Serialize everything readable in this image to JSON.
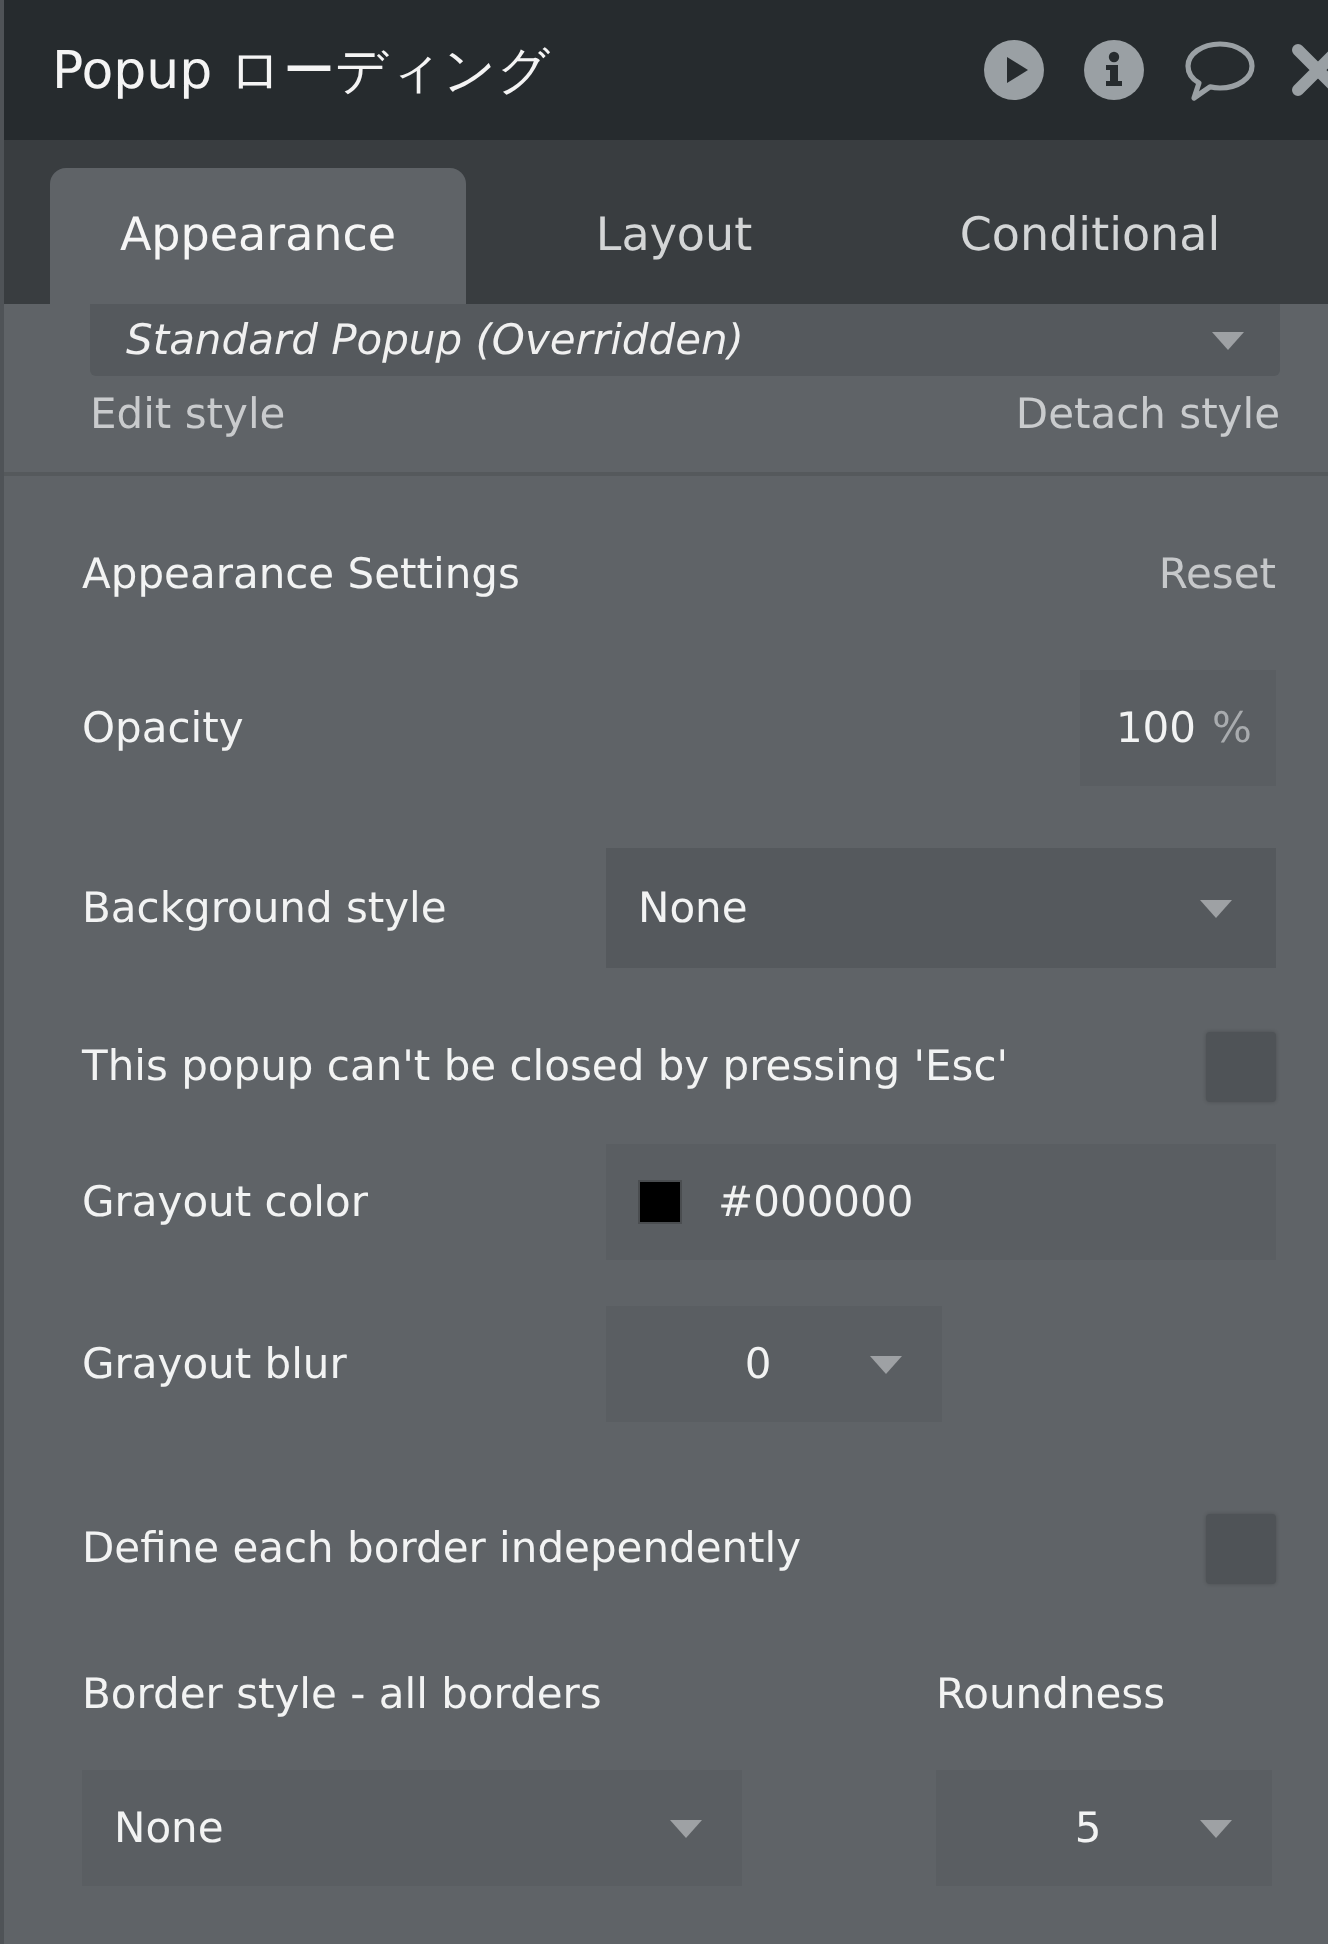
{
  "header": {
    "title": "Popup ローディング"
  },
  "tabs": [
    {
      "label": "Appearance",
      "selected": true
    },
    {
      "label": "Layout",
      "selected": false
    },
    {
      "label": "Conditional",
      "selected": false
    }
  ],
  "style": {
    "value": "Standard Popup (Overridden)",
    "edit_link": "Edit style",
    "detach_link": "Detach style"
  },
  "section": {
    "title": "Appearance Settings",
    "reset": "Reset"
  },
  "settings": [
    {
      "kind": "number",
      "label": "Opacity",
      "value": "100",
      "unit": "%"
    },
    {
      "kind": "dropdown",
      "label": "Background style",
      "value": "None"
    },
    {
      "kind": "checkbox",
      "label": "This popup can't be closed by pressing 'Esc'",
      "checked": false
    },
    {
      "kind": "color",
      "label": "Grayout color",
      "value": "#000000"
    },
    {
      "kind": "compact-dropdown",
      "label": "Grayout blur",
      "value": "0"
    },
    {
      "kind": "checkbox",
      "label": "Define each border independently",
      "checked": false
    }
  ],
  "border": {
    "style_label": "Border style - all borders",
    "style_value": "None",
    "roundness_label": "Roundness",
    "roundness_value": "5"
  }
}
